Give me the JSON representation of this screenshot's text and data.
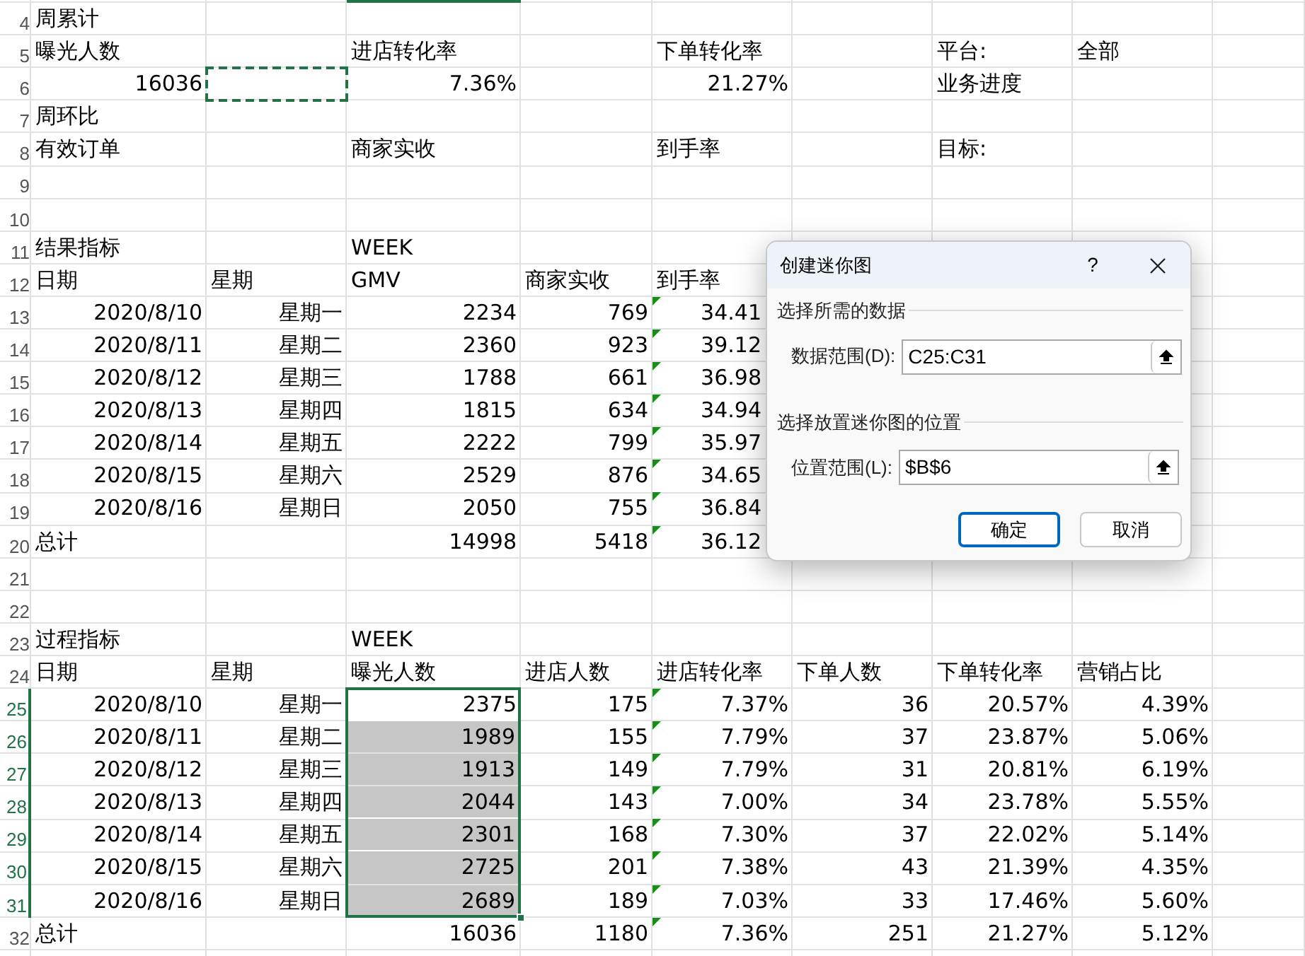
{
  "sheet": {
    "rows": [
      {
        "number": "4",
        "selected": false,
        "cells": {
          "a": {
            "text": "周累计"
          }
        }
      },
      {
        "number": "5",
        "selected": false,
        "cells": {
          "a": {
            "text": "曝光人数"
          },
          "c": {
            "text": "进店转化率"
          },
          "e": {
            "text": "下单转化率"
          },
          "g": {
            "text": "平台:"
          },
          "h": {
            "text": "全部"
          }
        }
      },
      {
        "number": "6",
        "selected": false,
        "cells": {
          "a": {
            "text": "16036",
            "kind": "number"
          },
          "b": {
            "marquee": true
          },
          "c": {
            "text": "7.36%",
            "kind": "number"
          },
          "e": {
            "text": "21.27%",
            "kind": "number"
          },
          "g": {
            "text": "业务进度"
          }
        }
      },
      {
        "number": "7",
        "selected": false,
        "cells": {
          "a": {
            "text": "周环比"
          }
        }
      },
      {
        "number": "8",
        "selected": false,
        "cells": {
          "a": {
            "text": "有效订单"
          },
          "c": {
            "text": "商家实收"
          },
          "e": {
            "text": "到手率"
          },
          "g": {
            "text": "目标:"
          }
        }
      },
      {
        "number": "9",
        "selected": false,
        "cells": {}
      },
      {
        "number": "10",
        "selected": false,
        "cells": {}
      },
      {
        "number": "11",
        "selected": false,
        "cells": {
          "a": {
            "text": "结果指标"
          },
          "c": {
            "text": "WEEK"
          }
        }
      },
      {
        "number": "12",
        "selected": false,
        "cells": {
          "a": {
            "text": "日期"
          },
          "b": {
            "text": "星期"
          },
          "c": {
            "text": "GMV"
          },
          "d": {
            "text": "商家实收"
          },
          "e": {
            "text": "到手率"
          }
        }
      },
      {
        "number": "13",
        "selected": false,
        "cells": {
          "a": {
            "text": "2020/8/10",
            "kind": "number"
          },
          "b": {
            "text": "星期一",
            "kind": "number"
          },
          "c": {
            "text": "2234",
            "kind": "number"
          },
          "d": {
            "text": "769",
            "kind": "number"
          },
          "e": {
            "text": "34.41",
            "kind": "cut_number",
            "flag": true
          }
        }
      },
      {
        "number": "14",
        "selected": false,
        "cells": {
          "a": {
            "text": "2020/8/11",
            "kind": "number"
          },
          "b": {
            "text": "星期二",
            "kind": "number"
          },
          "c": {
            "text": "2360",
            "kind": "number"
          },
          "d": {
            "text": "923",
            "kind": "number"
          },
          "e": {
            "text": "39.12",
            "kind": "cut_number",
            "flag": true
          }
        }
      },
      {
        "number": "15",
        "selected": false,
        "cells": {
          "a": {
            "text": "2020/8/12",
            "kind": "number"
          },
          "b": {
            "text": "星期三",
            "kind": "number"
          },
          "c": {
            "text": "1788",
            "kind": "number"
          },
          "d": {
            "text": "661",
            "kind": "number"
          },
          "e": {
            "text": "36.98",
            "kind": "cut_number",
            "flag": true
          }
        }
      },
      {
        "number": "16",
        "selected": false,
        "cells": {
          "a": {
            "text": "2020/8/13",
            "kind": "number"
          },
          "b": {
            "text": "星期四",
            "kind": "number"
          },
          "c": {
            "text": "1815",
            "kind": "number"
          },
          "d": {
            "text": "634",
            "kind": "number"
          },
          "e": {
            "text": "34.94",
            "kind": "cut_number",
            "flag": true
          }
        }
      },
      {
        "number": "17",
        "selected": false,
        "cells": {
          "a": {
            "text": "2020/8/14",
            "kind": "number"
          },
          "b": {
            "text": "星期五",
            "kind": "number"
          },
          "c": {
            "text": "2222",
            "kind": "number"
          },
          "d": {
            "text": "799",
            "kind": "number"
          },
          "e": {
            "text": "35.97",
            "kind": "cut_number",
            "flag": true
          }
        }
      },
      {
        "number": "18",
        "selected": false,
        "cells": {
          "a": {
            "text": "2020/8/15",
            "kind": "number"
          },
          "b": {
            "text": "星期六",
            "kind": "number"
          },
          "c": {
            "text": "2529",
            "kind": "number"
          },
          "d": {
            "text": "876",
            "kind": "number"
          },
          "e": {
            "text": "34.65",
            "kind": "cut_number",
            "flag": true
          }
        }
      },
      {
        "number": "19",
        "selected": false,
        "cells": {
          "a": {
            "text": "2020/8/16",
            "kind": "number"
          },
          "b": {
            "text": "星期日",
            "kind": "number"
          },
          "c": {
            "text": "2050",
            "kind": "number"
          },
          "d": {
            "text": "755",
            "kind": "number"
          },
          "e": {
            "text": "36.84",
            "kind": "cut_number",
            "flag": true
          }
        }
      },
      {
        "number": "20",
        "selected": false,
        "cells": {
          "a": {
            "text": "总计"
          },
          "c": {
            "text": "14998",
            "kind": "number"
          },
          "d": {
            "text": "5418",
            "kind": "number"
          },
          "e": {
            "text": "36.12",
            "kind": "cut_number",
            "flag": true
          }
        }
      },
      {
        "number": "21",
        "selected": false,
        "cells": {}
      },
      {
        "number": "22",
        "selected": false,
        "cells": {}
      },
      {
        "number": "23",
        "selected": false,
        "cells": {
          "a": {
            "text": "过程指标"
          },
          "c": {
            "text": "WEEK"
          }
        }
      },
      {
        "number": "24",
        "selected": false,
        "cells": {
          "a": {
            "text": "日期"
          },
          "b": {
            "text": "星期"
          },
          "c": {
            "text": "曝光人数"
          },
          "d": {
            "text": "进店人数"
          },
          "e": {
            "text": "进店转化率"
          },
          "f": {
            "text": "下单人数"
          },
          "g": {
            "text": "下单转化率"
          },
          "h": {
            "text": "营销占比"
          }
        }
      },
      {
        "number": "25",
        "selected": true,
        "cells": {
          "a": {
            "text": "2020/8/10",
            "kind": "number"
          },
          "b": {
            "text": "星期一",
            "kind": "number"
          },
          "c": {
            "text": "2375",
            "kind": "number",
            "selected": true,
            "active": true
          },
          "d": {
            "text": "175",
            "kind": "number"
          },
          "e": {
            "text": "7.37%",
            "kind": "number",
            "flag": true
          },
          "f": {
            "text": "36",
            "kind": "number"
          },
          "g": {
            "text": "20.57%",
            "kind": "number"
          },
          "h": {
            "text": "4.39%",
            "kind": "number"
          }
        }
      },
      {
        "number": "26",
        "selected": true,
        "cells": {
          "a": {
            "text": "2020/8/11",
            "kind": "number"
          },
          "b": {
            "text": "星期二",
            "kind": "number"
          },
          "c": {
            "text": "1989",
            "kind": "number",
            "selected": true,
            "active": false
          },
          "d": {
            "text": "155",
            "kind": "number"
          },
          "e": {
            "text": "7.79%",
            "kind": "number",
            "flag": true
          },
          "f": {
            "text": "37",
            "kind": "number"
          },
          "g": {
            "text": "23.87%",
            "kind": "number"
          },
          "h": {
            "text": "5.06%",
            "kind": "number"
          }
        }
      },
      {
        "number": "27",
        "selected": true,
        "cells": {
          "a": {
            "text": "2020/8/12",
            "kind": "number"
          },
          "b": {
            "text": "星期三",
            "kind": "number"
          },
          "c": {
            "text": "1913",
            "kind": "number",
            "selected": true,
            "active": false
          },
          "d": {
            "text": "149",
            "kind": "number"
          },
          "e": {
            "text": "7.79%",
            "kind": "number",
            "flag": true
          },
          "f": {
            "text": "31",
            "kind": "number"
          },
          "g": {
            "text": "20.81%",
            "kind": "number"
          },
          "h": {
            "text": "6.19%",
            "kind": "number"
          }
        }
      },
      {
        "number": "28",
        "selected": true,
        "cells": {
          "a": {
            "text": "2020/8/13",
            "kind": "number"
          },
          "b": {
            "text": "星期四",
            "kind": "number"
          },
          "c": {
            "text": "2044",
            "kind": "number",
            "selected": true,
            "active": false
          },
          "d": {
            "text": "143",
            "kind": "number"
          },
          "e": {
            "text": "7.00%",
            "kind": "number",
            "flag": true
          },
          "f": {
            "text": "34",
            "kind": "number"
          },
          "g": {
            "text": "23.78%",
            "kind": "number"
          },
          "h": {
            "text": "5.55%",
            "kind": "number"
          }
        }
      },
      {
        "number": "29",
        "selected": true,
        "cells": {
          "a": {
            "text": "2020/8/14",
            "kind": "number"
          },
          "b": {
            "text": "星期五",
            "kind": "number"
          },
          "c": {
            "text": "2301",
            "kind": "number",
            "selected": true,
            "active": false
          },
          "d": {
            "text": "168",
            "kind": "number"
          },
          "e": {
            "text": "7.30%",
            "kind": "number",
            "flag": true
          },
          "f": {
            "text": "37",
            "kind": "number"
          },
          "g": {
            "text": "22.02%",
            "kind": "number"
          },
          "h": {
            "text": "5.14%",
            "kind": "number"
          }
        }
      },
      {
        "number": "30",
        "selected": true,
        "cells": {
          "a": {
            "text": "2020/8/15",
            "kind": "number"
          },
          "b": {
            "text": "星期六",
            "kind": "number"
          },
          "c": {
            "text": "2725",
            "kind": "number",
            "selected": true,
            "active": false
          },
          "d": {
            "text": "201",
            "kind": "number"
          },
          "e": {
            "text": "7.38%",
            "kind": "number",
            "flag": true
          },
          "f": {
            "text": "43",
            "kind": "number"
          },
          "g": {
            "text": "21.39%",
            "kind": "number"
          },
          "h": {
            "text": "4.35%",
            "kind": "number"
          }
        }
      },
      {
        "number": "31",
        "selected": true,
        "cells": {
          "a": {
            "text": "2020/8/16",
            "kind": "number"
          },
          "b": {
            "text": "星期日",
            "kind": "number"
          },
          "c": {
            "text": "2689",
            "kind": "number",
            "selected": true,
            "active": false
          },
          "d": {
            "text": "189",
            "kind": "number"
          },
          "e": {
            "text": "7.03%",
            "kind": "number",
            "flag": true
          },
          "f": {
            "text": "33",
            "kind": "number"
          },
          "g": {
            "text": "17.46%",
            "kind": "number"
          },
          "h": {
            "text": "5.60%",
            "kind": "number"
          }
        }
      },
      {
        "number": "32",
        "selected": false,
        "cells": {
          "a": {
            "text": "总计"
          },
          "c": {
            "text": "16036",
            "kind": "number"
          },
          "d": {
            "text": "1180",
            "kind": "number"
          },
          "e": {
            "text": "7.36%",
            "kind": "number",
            "flag": true
          },
          "f": {
            "text": "251",
            "kind": "number"
          },
          "g": {
            "text": "21.27%",
            "kind": "number"
          },
          "h": {
            "text": "5.12%",
            "kind": "number"
          }
        }
      }
    ]
  },
  "dialog": {
    "title": "创建迷你图",
    "help": "?",
    "groups": [
      {
        "heading": "选择所需的数据",
        "field_label": "数据范围(D):",
        "value": "C25:C31"
      },
      {
        "heading": "选择放置迷你图的位置",
        "field_label": "位置范围(L):",
        "value": "$B$6"
      }
    ],
    "buttons": [
      {
        "label": "确定",
        "default": true
      },
      {
        "label": "取消",
        "default": false
      }
    ]
  }
}
